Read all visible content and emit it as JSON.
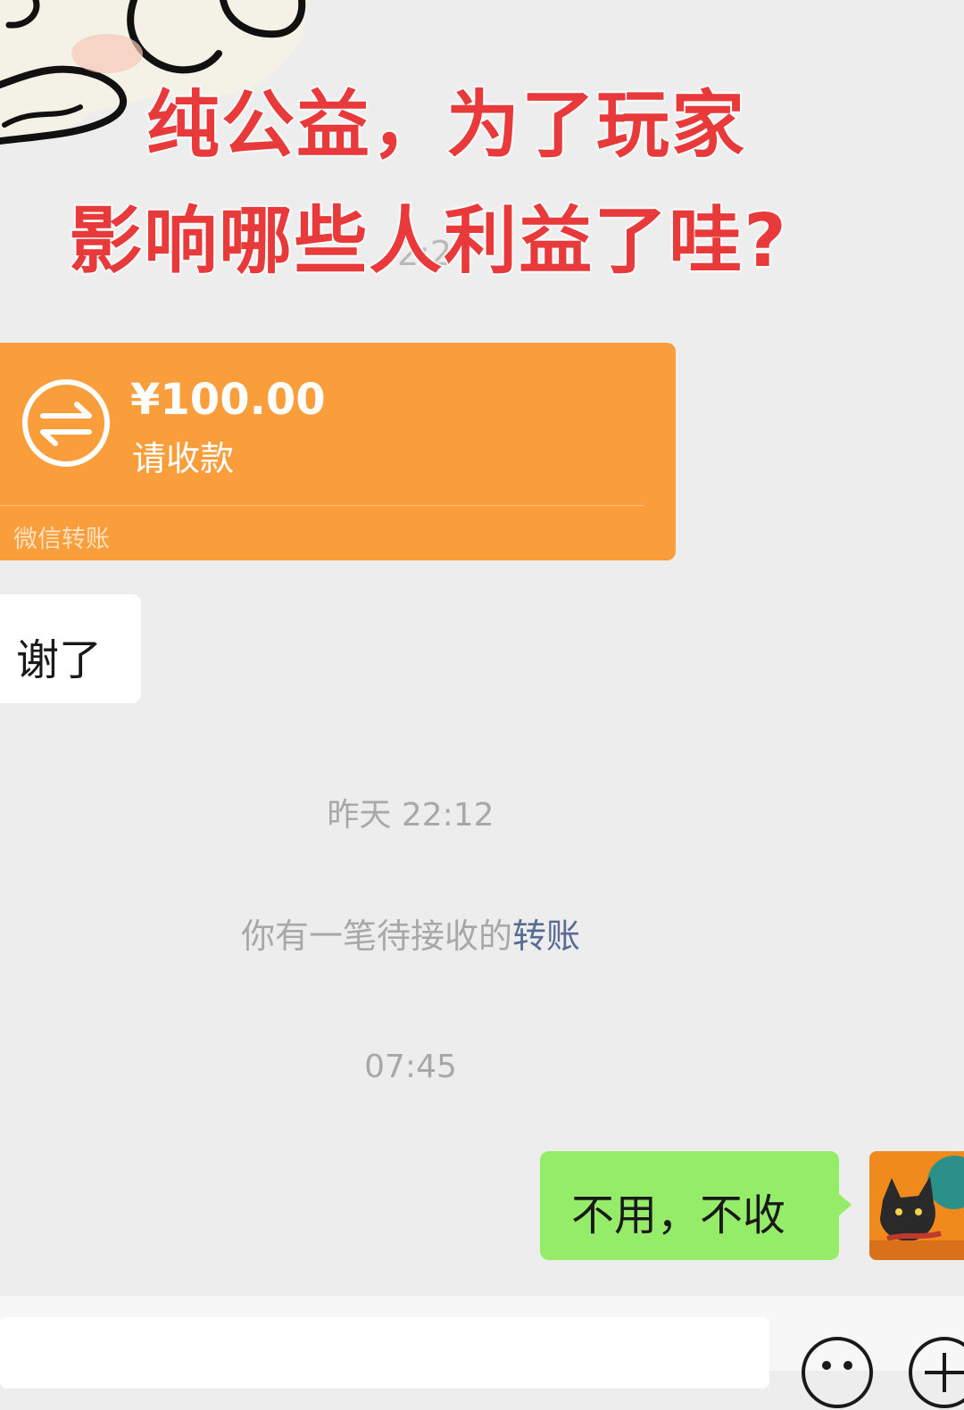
{
  "caption": {
    "line1": "纯公益，为了玩家",
    "line2": "影响哪些人利益了哇?"
  },
  "obscured_time": "2:2",
  "transfer": {
    "amount": "¥100.00",
    "status": "请收款",
    "footer": "微信转账",
    "card_color": "#fa9d3b",
    "icon": "transfer-arrows-icon"
  },
  "incoming_message": "谢了",
  "timestamps": {
    "first": "昨天 22:12",
    "second": "07:45"
  },
  "system_notice": {
    "text": "你有一笔待接收的",
    "link": "转账",
    "link_color": "#576b95"
  },
  "outgoing_message": "不用，不收",
  "colors": {
    "chat_background": "#ededed",
    "outgoing_bubble": "#95ec69",
    "caption_text": "#e83a3a"
  },
  "input_bar": {
    "value": "",
    "icons": [
      "emoji-icon",
      "plus-icon"
    ]
  }
}
